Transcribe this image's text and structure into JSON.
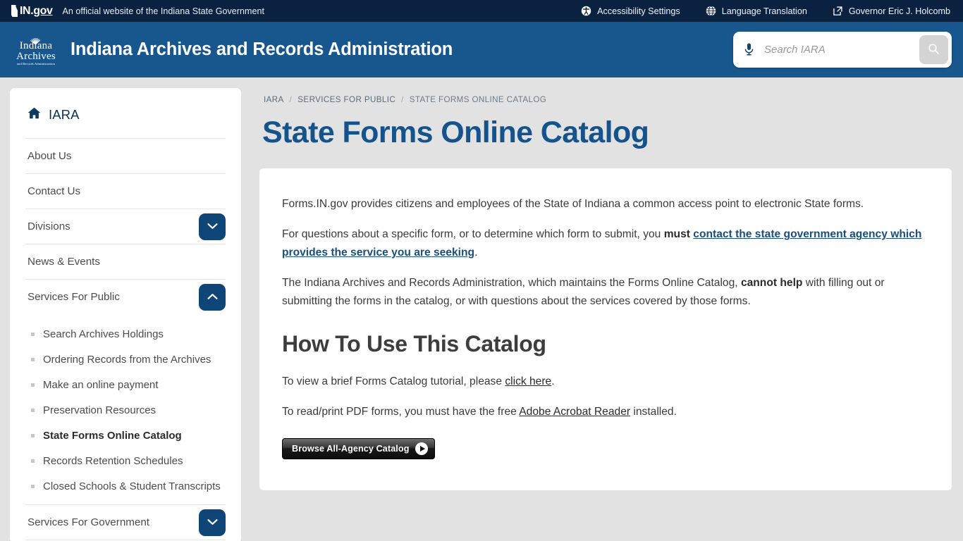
{
  "topbar": {
    "logo_text_in": "IN",
    "logo_text_dot": ".",
    "logo_text_gov": "gov",
    "tagline": "An official website of the Indiana State Government",
    "links": [
      {
        "label": "Accessibility Settings",
        "icon": "accessibility-icon"
      },
      {
        "label": "Language Translation",
        "icon": "globe-icon"
      },
      {
        "label": "Governor Eric J. Holcomb",
        "icon": "external-link-icon"
      }
    ]
  },
  "header": {
    "logo_line1": "Indiana",
    "logo_line2": "Archives",
    "logo_line3": "and Records Administration",
    "site_title": "Indiana Archives and Records Administration",
    "search": {
      "placeholder": "Search IARA",
      "value": "",
      "mic_icon": "microphone-icon",
      "submit_icon": "search-icon"
    }
  },
  "sidebar": {
    "home_label": "IARA",
    "home_icon": "home-icon",
    "items": [
      {
        "label": "About Us",
        "expandable": false
      },
      {
        "label": "Contact Us",
        "expandable": false
      },
      {
        "label": "Divisions",
        "expandable": true,
        "expanded": false
      },
      {
        "label": "News & Events",
        "expandable": false
      },
      {
        "label": "Services For Public",
        "expandable": true,
        "expanded": true
      },
      {
        "label": "Services For Government",
        "expandable": true,
        "expanded": false
      }
    ],
    "sub_items": [
      {
        "label": "Search Archives Holdings",
        "current": false
      },
      {
        "label": "Ordering Records from the Archives",
        "current": false
      },
      {
        "label": "Make an online payment",
        "current": false
      },
      {
        "label": "Preservation Resources",
        "current": false
      },
      {
        "label": "State Forms Online Catalog",
        "current": true
      },
      {
        "label": "Records Retention Schedules",
        "current": false
      },
      {
        "label": "Closed Schools & Student Transcripts",
        "current": false
      }
    ]
  },
  "main": {
    "breadcrumb": [
      {
        "label": "IARA"
      },
      {
        "label": "SERVICES FOR PUBLIC"
      },
      {
        "label": "STATE FORMS ONLINE CATALOG"
      }
    ],
    "breadcrumb_separator": "/",
    "title": "State Forms Online Catalog",
    "paragraph_1": "Forms.IN.gov provides citizens and employees of the State of Indiana a common access point to electronic State forms.",
    "paragraph_2": {
      "before": "For questions about a specific form, or to determine which form to submit, you ",
      "bold": "must",
      "space": " ",
      "link": "contact the state government agency which provides the service you are seeking",
      "after": "."
    },
    "paragraph_3": {
      "before": "The Indiana Archives and Records Administration, which maintains the Forms Online Catalog, ",
      "bold": "cannot help",
      "after": " with filling out or submitting the forms in the catalog, or with questions about the services covered by those forms."
    },
    "section_heading": "How To Use This Catalog",
    "paragraph_4": {
      "before": "To view a brief Forms Catalog tutorial, please ",
      "link": "click here",
      "after": "."
    },
    "paragraph_5": {
      "before": "To read/print PDF forms, you must have the free ",
      "link": "Adobe Acrobat Reader",
      "after": " installed."
    },
    "browse_button": {
      "label": "Browse All-Agency Catalog",
      "icon": "play-arrow-icon"
    }
  },
  "colors": {
    "topbar_bg": "#0a2240",
    "header_bg": "#17578d",
    "page_bg": "#e2e2e2",
    "accent_navy": "#0f4677",
    "title_blue": "#15538c",
    "link_blue": "#1a4e7e"
  }
}
